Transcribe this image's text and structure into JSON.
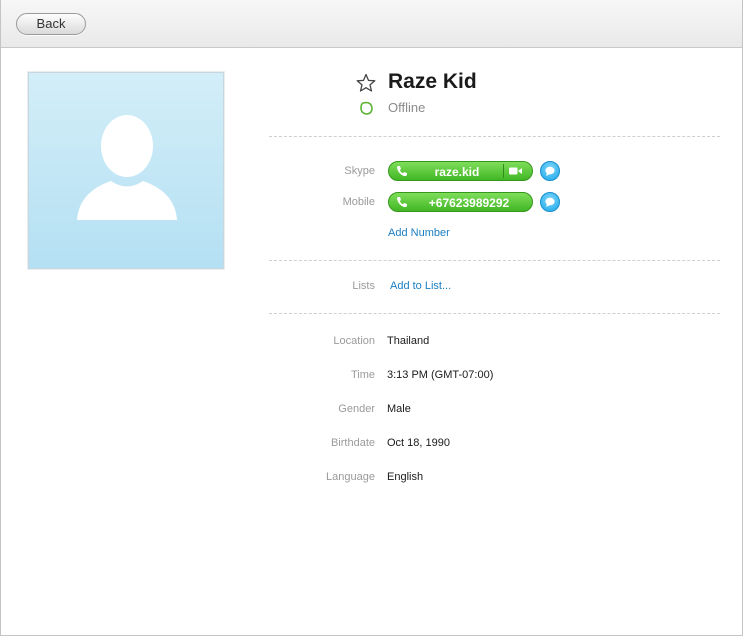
{
  "toolbar": {
    "back_label": "Back"
  },
  "contact": {
    "name": "Raze Kid",
    "status": "Offline"
  },
  "numbers": {
    "skype_label": "Skype",
    "skype_value": "raze.kid",
    "mobile_label": "Mobile",
    "mobile_value": "+67623989292",
    "add_number": "Add Number"
  },
  "lists": {
    "label": "Lists",
    "add_to_list": "Add to List..."
  },
  "details": [
    {
      "label": "Location",
      "value": "Thailand"
    },
    {
      "label": "Time",
      "value": "3:13 PM (GMT-07:00)"
    },
    {
      "label": "Gender",
      "value": "Male"
    },
    {
      "label": "Birthdate",
      "value": "Oct 18, 1990"
    },
    {
      "label": "Language",
      "value": "English"
    }
  ],
  "colors": {
    "call_green": "#41b725",
    "chat_blue": "#1aa7e9",
    "link_blue": "#1b7ec2",
    "status_green": "#5fb43a"
  },
  "icons": [
    "star-icon",
    "status-icon",
    "phone-icon",
    "video-icon",
    "chat-icon",
    "avatar-placeholder-icon"
  ]
}
